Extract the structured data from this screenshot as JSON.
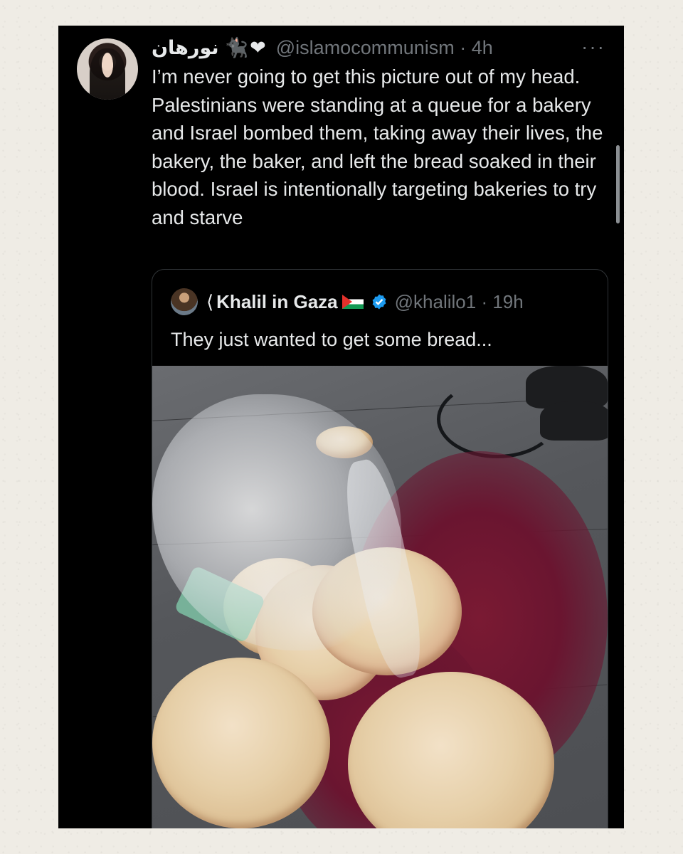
{
  "tweet": {
    "display_name": "نورهان",
    "emojis": "🐈‍⬛❤",
    "handle": "@islamocommunism · 4h",
    "more": "···",
    "text": "I’m never going to get this picture out of my head. Palestinians were standing at a queue for a bakery and Israel bombed them, taking away their lives, the bakery, the baker, and left the bread soaked in their blood. Israel is intentionally targeting bakeries to try and starve"
  },
  "quote": {
    "name_prefix": "⟨",
    "display_name": "Khalil in Gaza",
    "handle": "@khalilo1 · 19h",
    "text": "They just wanted to get some bread...",
    "verified_color": "#1d9bf0"
  },
  "colors": {
    "background": "#efece5",
    "card": "#000000",
    "text": "#e7e9ea",
    "muted": "#71767b",
    "heart": "#e0213a"
  }
}
